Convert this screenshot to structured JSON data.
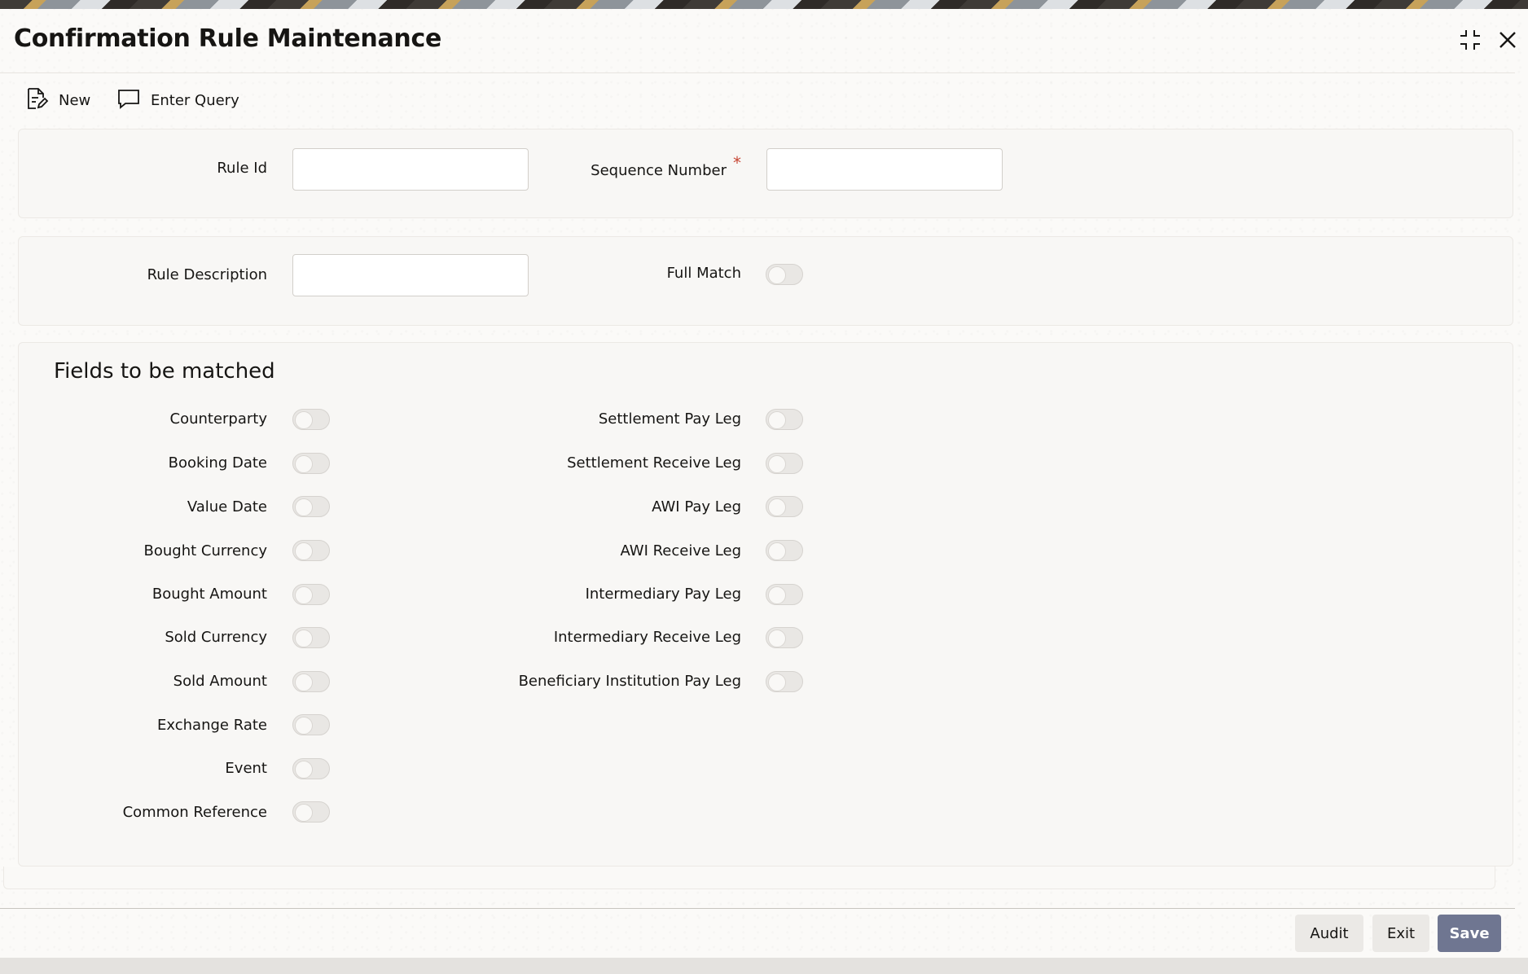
{
  "window": {
    "title": "Confirmation Rule Maintenance",
    "controls": {
      "restore_icon": "minimize-icon",
      "close_icon": "close-icon"
    }
  },
  "toolbar": {
    "new_label": "New",
    "new_icon": "new-document-icon",
    "enter_query_label": "Enter Query",
    "enter_query_icon": "chat-bubble-icon"
  },
  "header_panel": {
    "rule_id": {
      "label": "Rule Id",
      "value": ""
    },
    "sequence_number": {
      "label": "Sequence Number",
      "required_marker": "*",
      "value": ""
    }
  },
  "description_panel": {
    "rule_description": {
      "label": "Rule Description",
      "value": ""
    },
    "full_match": {
      "label": "Full Match",
      "on": false
    }
  },
  "fields_section": {
    "title": "Fields to be matched",
    "left_column": [
      {
        "label": "Counterparty",
        "on": false
      },
      {
        "label": "Booking Date",
        "on": false
      },
      {
        "label": "Value Date",
        "on": false
      },
      {
        "label": "Bought Currency",
        "on": false
      },
      {
        "label": "Bought Amount",
        "on": false
      },
      {
        "label": "Sold Currency",
        "on": false
      },
      {
        "label": "Sold Amount",
        "on": false
      },
      {
        "label": "Exchange Rate",
        "on": false
      },
      {
        "label": "Event",
        "on": false
      },
      {
        "label": "Common Reference",
        "on": false
      }
    ],
    "right_column": [
      {
        "label": "Settlement Pay Leg",
        "on": false
      },
      {
        "label": "Settlement Receive Leg",
        "on": false
      },
      {
        "label": "AWI Pay Leg",
        "on": false
      },
      {
        "label": "AWI Receive Leg",
        "on": false
      },
      {
        "label": "Intermediary Pay Leg",
        "on": false
      },
      {
        "label": "Intermediary Receive Leg",
        "on": false
      },
      {
        "label": "Beneficiary Institution Pay Leg",
        "on": false
      }
    ]
  },
  "footer": {
    "audit_label": "Audit",
    "exit_label": "Exit",
    "save_label": "Save"
  },
  "colors": {
    "required": "#c74634",
    "save_button": "#6f7691"
  }
}
